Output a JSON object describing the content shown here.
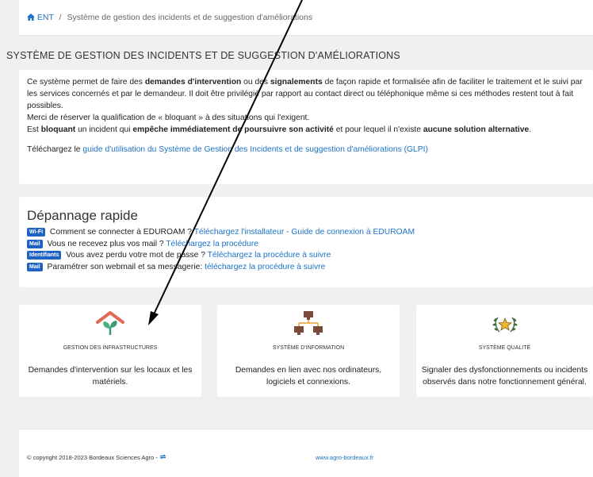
{
  "breadcrumb": {
    "home": "ENT",
    "separator": "/",
    "current": "Système de gestion des incidents et de suggestion d'améliorations"
  },
  "page_title": "SYSTÈME DE GESTION DES INCIDENTS ET DE SUGGESTION D'AMÉLIORATIONS",
  "intro": {
    "p1_a": "Ce système permet de faire des ",
    "p1_b": "demandes d'intervention",
    "p1_c": " ou des ",
    "p1_d": "signalements",
    "p1_e": " de façon rapide et formalisée afin de faciliter le traitement et le suivi par les services concernés et par le demandeur. Il doit être privilégié par rapport au contact direct ou téléphonique même si ces méthodes restent tout à fait possibles.",
    "p2": "Merci de réserver la qualification de « bloquant » à des situations qui l'exigent.",
    "p3_a": "Est ",
    "p3_b": "bloquant",
    "p3_c": " un incident qui ",
    "p3_d": "empêche immédiatement de poursuivre son activité",
    "p3_e": " et pour lequel il n'existe ",
    "p3_f": "aucune solution alternative",
    "p3_g": ".",
    "download_prefix": "Téléchargez le ",
    "download_link": "guide d'utilisation du Système de Gestion des Incidents et de suggestion d'améliorations (GLPI)"
  },
  "quick": {
    "title": "Dépannage rapide",
    "items": [
      {
        "badge": "Wi-Fi",
        "text": " Comment se connecter à EDUROAM ? ",
        "link": "Téléchargez l'installateur - Guide de connexion à EDUROAM"
      },
      {
        "badge": "Mail",
        "text": " Vous ne recevez plus vos mail ? ",
        "link": "Téléchargez la procédure"
      },
      {
        "badge": "Identifiants",
        "text": " Vous avez perdu votre mot de passe ? ",
        "link": "Téléchargez la procédure à suivre"
      },
      {
        "badge": "Mail",
        "text": " Paramétrer son webmail et sa messagerie: ",
        "link": "téléchargez la procédure à suivre"
      }
    ]
  },
  "tiles": [
    {
      "icon": "house-plant-icon",
      "title": "GESTION DES INFRASTRUCTURES",
      "desc": "Demandes d'intervention sur les locaux et les matériels."
    },
    {
      "icon": "network-computers-icon",
      "title": "SYSTÈME D'INFORMATION",
      "desc": "Demandes en lien avec nos ordinateurs, logiciels et connexions."
    },
    {
      "icon": "laurel-star-icon",
      "title": "SYSTÈME QUALITÉ",
      "desc": "Signaler des dysfonctionnements ou incidents observés dans notre fonctionnement général."
    }
  ],
  "footer": {
    "copyright": "© copyright 2018-2023 Bordeaux Sciences Agro -",
    "link": "www.agro-bordeaux.fr"
  },
  "colors": {
    "link": "#1a73c8",
    "badge": "#1e63c4",
    "background": "#f0f0f0"
  }
}
